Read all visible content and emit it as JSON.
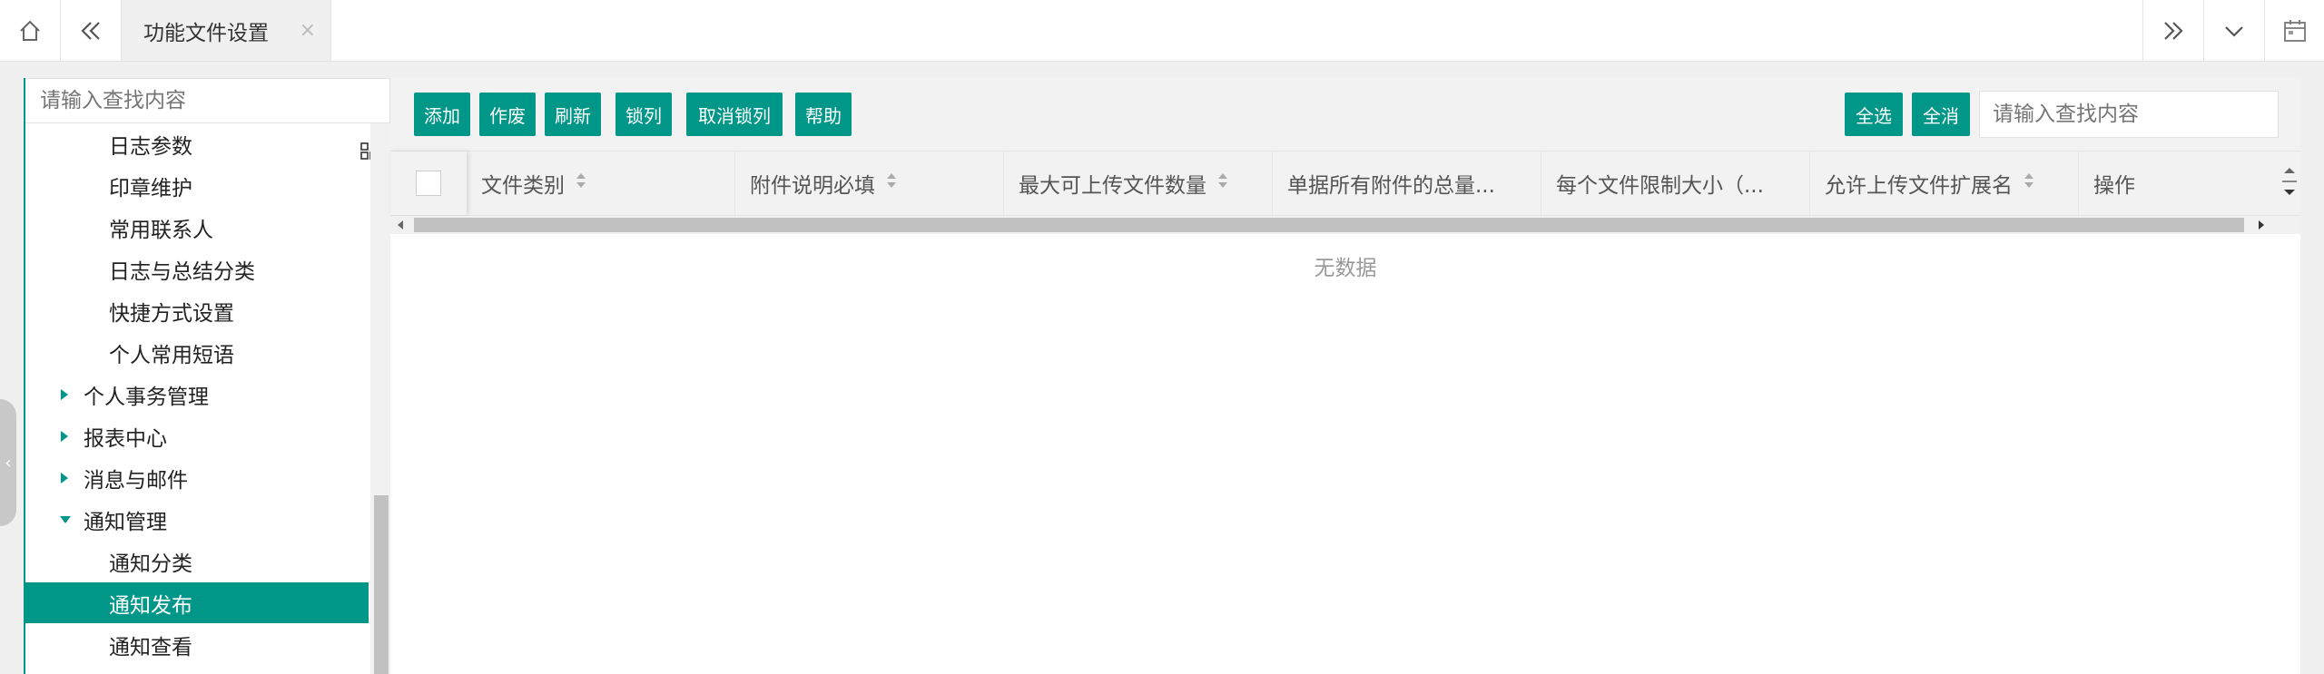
{
  "colors": {
    "accent": "#009688",
    "background": "#f0f0f0"
  },
  "topbar": {
    "home_icon": "home-icon",
    "back_icon": "double-chevron-left-icon",
    "active_tab": {
      "label": "功能文件设置",
      "close": "×"
    },
    "forward_icon": "double-chevron-right-icon",
    "dropdown_icon": "chevron-down-icon",
    "calendar_icon": "calendar-icon"
  },
  "sidebar": {
    "search_placeholder": "请输入查找内容",
    "items": [
      {
        "label": "日志参数",
        "level": 2
      },
      {
        "label": "印章维护",
        "level": 2
      },
      {
        "label": "常用联系人",
        "level": 2
      },
      {
        "label": "日志与总结分类",
        "level": 2
      },
      {
        "label": "快捷方式设置",
        "level": 2
      },
      {
        "label": "个人常用短语",
        "level": 2
      },
      {
        "label": "个人事务管理",
        "level": 1,
        "state": "collapsed"
      },
      {
        "label": "报表中心",
        "level": 1,
        "state": "collapsed"
      },
      {
        "label": "消息与邮件",
        "level": 1,
        "state": "collapsed"
      },
      {
        "label": "通知管理",
        "level": 1,
        "state": "expanded"
      },
      {
        "label": "通知分类",
        "level": 2
      },
      {
        "label": "通知发布",
        "level": 2,
        "selected": true
      },
      {
        "label": "通知查看",
        "level": 2
      }
    ]
  },
  "toolbar": {
    "add": "添加",
    "void": "作废",
    "refresh": "刷新",
    "lock_col": "锁列",
    "unlock_col": "取消锁列",
    "help": "帮助",
    "select_all": "全选",
    "deselect_all": "全消",
    "search_placeholder": "请输入查找内容"
  },
  "table": {
    "columns": [
      "文件类别",
      "附件说明必填",
      "最大可上传文件数量",
      "单据所有附件的总量...",
      "每个文件限制大小（...",
      "允许上传文件扩展名",
      "操作"
    ],
    "empty_text": "无数据"
  }
}
